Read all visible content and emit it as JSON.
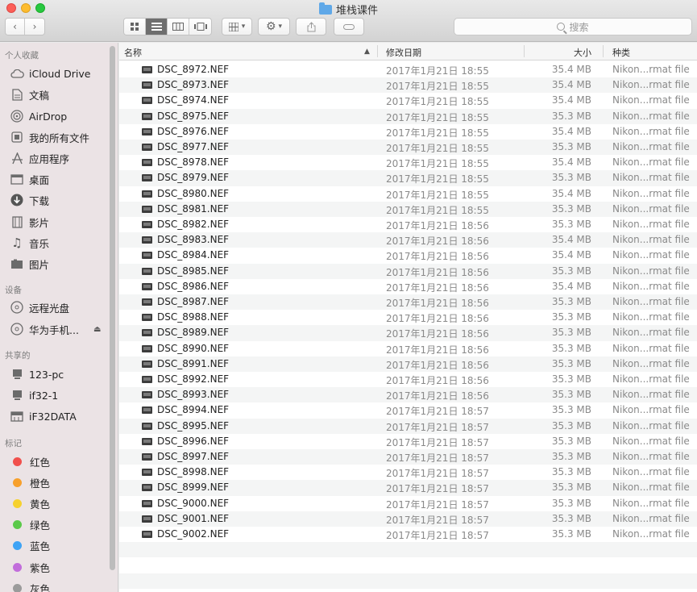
{
  "window": {
    "title": "堆栈课件"
  },
  "toolbar": {
    "back_icon": "chevron-left-icon",
    "forward_icon": "chevron-right-icon",
    "search_placeholder": "搜索"
  },
  "sidebar": {
    "sections": [
      {
        "header": "个人收藏",
        "items": [
          {
            "label": "iCloud Drive",
            "icon": "cloud-icon"
          },
          {
            "label": "文稿",
            "icon": "document-icon"
          },
          {
            "label": "AirDrop",
            "icon": "airdrop-icon"
          },
          {
            "label": "我的所有文件",
            "icon": "all-files-icon"
          },
          {
            "label": "应用程序",
            "icon": "applications-icon"
          },
          {
            "label": "桌面",
            "icon": "desktop-icon"
          },
          {
            "label": "下载",
            "icon": "download-icon"
          },
          {
            "label": "影片",
            "icon": "movies-icon"
          },
          {
            "label": "音乐",
            "icon": "music-icon"
          },
          {
            "label": "图片",
            "icon": "pictures-icon"
          }
        ]
      },
      {
        "header": "设备",
        "items": [
          {
            "label": "远程光盘",
            "icon": "disc-icon"
          },
          {
            "label": "华为手机...",
            "icon": "disc-icon"
          }
        ]
      },
      {
        "header": "共享的",
        "items": [
          {
            "label": "123-pc",
            "icon": "computer-icon"
          },
          {
            "label": "if32-1",
            "icon": "computer-icon"
          },
          {
            "label": "iF32DATA",
            "icon": "server-icon"
          }
        ]
      },
      {
        "header": "标记",
        "items": [
          {
            "label": "红色",
            "color": "#f1504c"
          },
          {
            "label": "橙色",
            "color": "#f7a02c"
          },
          {
            "label": "黄色",
            "color": "#f6d12f"
          },
          {
            "label": "绿色",
            "color": "#5bc94a"
          },
          {
            "label": "蓝色",
            "color": "#3ea3f5"
          },
          {
            "label": "紫色",
            "color": "#c26ddb"
          },
          {
            "label": "灰色",
            "color": "#9b9b9b"
          }
        ]
      }
    ]
  },
  "columns": {
    "name": "名称",
    "date": "修改日期",
    "size": "大小",
    "kind": "种类"
  },
  "files": [
    {
      "name": "DSC_8972.NEF",
      "date": "2017年1月21日 18:55",
      "size": "35.4 MB",
      "kind": "Nikon...rmat file"
    },
    {
      "name": "DSC_8973.NEF",
      "date": "2017年1月21日 18:55",
      "size": "35.4 MB",
      "kind": "Nikon...rmat file"
    },
    {
      "name": "DSC_8974.NEF",
      "date": "2017年1月21日 18:55",
      "size": "35.4 MB",
      "kind": "Nikon...rmat file"
    },
    {
      "name": "DSC_8975.NEF",
      "date": "2017年1月21日 18:55",
      "size": "35.3 MB",
      "kind": "Nikon...rmat file"
    },
    {
      "name": "DSC_8976.NEF",
      "date": "2017年1月21日 18:55",
      "size": "35.4 MB",
      "kind": "Nikon...rmat file"
    },
    {
      "name": "DSC_8977.NEF",
      "date": "2017年1月21日 18:55",
      "size": "35.3 MB",
      "kind": "Nikon...rmat file"
    },
    {
      "name": "DSC_8978.NEF",
      "date": "2017年1月21日 18:55",
      "size": "35.4 MB",
      "kind": "Nikon...rmat file"
    },
    {
      "name": "DSC_8979.NEF",
      "date": "2017年1月21日 18:55",
      "size": "35.3 MB",
      "kind": "Nikon...rmat file"
    },
    {
      "name": "DSC_8980.NEF",
      "date": "2017年1月21日 18:55",
      "size": "35.4 MB",
      "kind": "Nikon...rmat file"
    },
    {
      "name": "DSC_8981.NEF",
      "date": "2017年1月21日 18:55",
      "size": "35.3 MB",
      "kind": "Nikon...rmat file"
    },
    {
      "name": "DSC_8982.NEF",
      "date": "2017年1月21日 18:56",
      "size": "35.3 MB",
      "kind": "Nikon...rmat file"
    },
    {
      "name": "DSC_8983.NEF",
      "date": "2017年1月21日 18:56",
      "size": "35.4 MB",
      "kind": "Nikon...rmat file"
    },
    {
      "name": "DSC_8984.NEF",
      "date": "2017年1月21日 18:56",
      "size": "35.4 MB",
      "kind": "Nikon...rmat file"
    },
    {
      "name": "DSC_8985.NEF",
      "date": "2017年1月21日 18:56",
      "size": "35.3 MB",
      "kind": "Nikon...rmat file"
    },
    {
      "name": "DSC_8986.NEF",
      "date": "2017年1月21日 18:56",
      "size": "35.4 MB",
      "kind": "Nikon...rmat file"
    },
    {
      "name": "DSC_8987.NEF",
      "date": "2017年1月21日 18:56",
      "size": "35.3 MB",
      "kind": "Nikon...rmat file"
    },
    {
      "name": "DSC_8988.NEF",
      "date": "2017年1月21日 18:56",
      "size": "35.3 MB",
      "kind": "Nikon...rmat file"
    },
    {
      "name": "DSC_8989.NEF",
      "date": "2017年1月21日 18:56",
      "size": "35.3 MB",
      "kind": "Nikon...rmat file"
    },
    {
      "name": "DSC_8990.NEF",
      "date": "2017年1月21日 18:56",
      "size": "35.3 MB",
      "kind": "Nikon...rmat file"
    },
    {
      "name": "DSC_8991.NEF",
      "date": "2017年1月21日 18:56",
      "size": "35.3 MB",
      "kind": "Nikon...rmat file"
    },
    {
      "name": "DSC_8992.NEF",
      "date": "2017年1月21日 18:56",
      "size": "35.3 MB",
      "kind": "Nikon...rmat file"
    },
    {
      "name": "DSC_8993.NEF",
      "date": "2017年1月21日 18:56",
      "size": "35.3 MB",
      "kind": "Nikon...rmat file"
    },
    {
      "name": "DSC_8994.NEF",
      "date": "2017年1月21日 18:57",
      "size": "35.3 MB",
      "kind": "Nikon...rmat file"
    },
    {
      "name": "DSC_8995.NEF",
      "date": "2017年1月21日 18:57",
      "size": "35.3 MB",
      "kind": "Nikon...rmat file"
    },
    {
      "name": "DSC_8996.NEF",
      "date": "2017年1月21日 18:57",
      "size": "35.3 MB",
      "kind": "Nikon...rmat file"
    },
    {
      "name": "DSC_8997.NEF",
      "date": "2017年1月21日 18:57",
      "size": "35.3 MB",
      "kind": "Nikon...rmat file"
    },
    {
      "name": "DSC_8998.NEF",
      "date": "2017年1月21日 18:57",
      "size": "35.3 MB",
      "kind": "Nikon...rmat file"
    },
    {
      "name": "DSC_8999.NEF",
      "date": "2017年1月21日 18:57",
      "size": "35.3 MB",
      "kind": "Nikon...rmat file"
    },
    {
      "name": "DSC_9000.NEF",
      "date": "2017年1月21日 18:57",
      "size": "35.3 MB",
      "kind": "Nikon...rmat file"
    },
    {
      "name": "DSC_9001.NEF",
      "date": "2017年1月21日 18:57",
      "size": "35.3 MB",
      "kind": "Nikon...rmat file"
    },
    {
      "name": "DSC_9002.NEF",
      "date": "2017年1月21日 18:57",
      "size": "35.3 MB",
      "kind": "Nikon...rmat file"
    }
  ]
}
